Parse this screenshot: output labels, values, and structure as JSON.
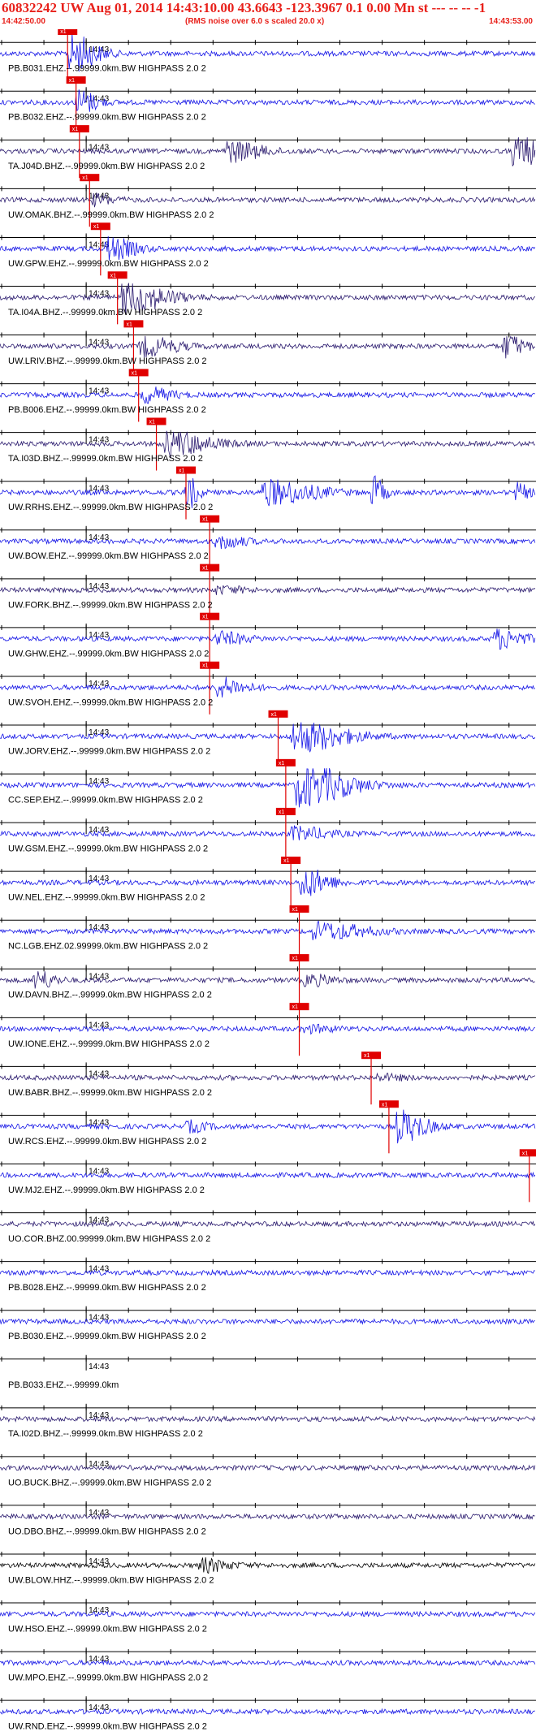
{
  "header": {
    "title": "60832242 UW Aug 01, 2014 14:43:10.00   43.6643 -123.3967  0.1 0.00 Mn st --- -- --  -1",
    "start_time": "14:42:50.00",
    "note": "(RMS noise over 6.0 s scaled 20.0 x)",
    "end_time": "14:43:53.00"
  },
  "colors": {
    "header_text": "#e8201a",
    "trace_blue": "#1414e6",
    "trace_dark": "#2a1a6e",
    "trace_black": "#000000",
    "pick": "#e00000"
  },
  "chart_data": {
    "type": "line",
    "title": "60832242 UW Aug 01, 2014 14:43:10.00   43.6643 -123.3967  0.1 0.00 Mn st --- -- --  -1",
    "x_range_time": [
      "14:42:50.00",
      "14:43:53.00"
    ],
    "x_tick_label": "14:43",
    "pick_label": "x1",
    "series": [
      {
        "name": "PB.B031.EHZ.--.99999.0km.BW_HIGHPASS_2.0_2",
        "label": "PB.B031.EHZ.--.99999.0km.BW  HIGHPASS  2.0  2",
        "pick": "14:42:57.8",
        "burst": [
          {
            "t": "14:42:58.0",
            "amp": 0.95,
            "dur": 3
          }
        ],
        "color": "blue"
      },
      {
        "name": "PB.B032.EHZ.--.99999.0km.BW_HIGHPASS_2.0_2",
        "label": "PB.B032.EHZ.--.99999.0km.BW  HIGHPASS  2.0  2",
        "pick": "14:42:58.8",
        "burst": [
          {
            "t": "14:42:59.0",
            "amp": 0.6,
            "dur": 2
          }
        ],
        "color": "blue"
      },
      {
        "name": "TA.J04D.BHZ.--.99999.0km.BW_HIGHPASS_2.0_2",
        "label": "TA.J04D.BHZ.--.99999.0km.BW  HIGHPASS  2.0  2",
        "pick": "14:42:59.2",
        "burst": [
          {
            "t": "14:43:16.5",
            "amp": 0.5,
            "dur": 4
          },
          {
            "t": "14:43:50.5",
            "amp": 0.65,
            "dur": 7
          }
        ],
        "color": "dark"
      },
      {
        "name": "UW.OMAK.BHZ.--.99999.0km.BW_HIGHPASS_2.0_2",
        "label": "UW.OMAK.BHZ.--.99999.0km.BW  HIGHPASS  2.0  2",
        "pick": "14:43:00.4",
        "burst": [
          {
            "t": "14:43:01.0",
            "amp": 0.25,
            "dur": 2
          }
        ],
        "color": "dark"
      },
      {
        "name": "UW.GPW.EHZ.--.99999.0km.BW_HIGHPASS_2.0_2",
        "label": "UW.GPW.EHZ.--.99999.0km.BW  HIGHPASS  2.0  2",
        "pick": "14:43:01.7",
        "burst": [
          {
            "t": "14:43:02.5",
            "amp": 0.55,
            "dur": 3
          }
        ],
        "color": "blue"
      },
      {
        "name": "TA.I04A.BHZ.--.99999.0km.BW_HIGHPASS_2.0_2",
        "label": "TA.I04A.BHZ.--.99999.0km.BW  HIGHPASS  2.0  2",
        "pick": "14:43:03.7",
        "burst": [
          {
            "t": "14:43:04.5",
            "amp": 0.75,
            "dur": 5
          }
        ],
        "color": "dark"
      },
      {
        "name": "UW.LRIV.BHZ.--.99999.0km.BW_HIGHPASS_2.0_2",
        "label": "UW.LRIV.BHZ.--.99999.0km.BW  HIGHPASS  2.0  2",
        "pick": "14:43:05.6",
        "burst": [
          {
            "t": "14:43:06.5",
            "amp": 0.45,
            "dur": 4
          },
          {
            "t": "14:43:49.5",
            "amp": 0.55,
            "dur": 2
          }
        ],
        "color": "dark"
      },
      {
        "name": "PB.B006.EHZ.--.99999.0km.BW_HIGHPASS_2.0_2",
        "label": "PB.B006.EHZ.--.99999.0km.BW  HIGHPASS  2.0  2",
        "pick": "14:43:06.2",
        "burst": [
          {
            "t": "14:43:06.8",
            "amp": 0.35,
            "dur": 3
          }
        ],
        "color": "blue"
      },
      {
        "name": "TA.I03D.BHZ.--.99999.0km.BW_HIGHPASS_2.0_2",
        "label": "TA.I03D.BHZ.--.99999.0km.BW  HIGHPASS  2.0  2",
        "pick": "14:43:08.3",
        "burst": [
          {
            "t": "14:43:09.5",
            "amp": 0.6,
            "dur": 5
          }
        ],
        "color": "dark"
      },
      {
        "name": "UW.RRHS.EHZ.--.99999.0km.BW_HIGHPASS_2.0_2",
        "label": "UW.RRHS.EHZ.--.99999.0km.BW  HIGHPASS  2.0  2",
        "pick": "14:43:11.8",
        "burst": [
          {
            "t": "14:43:11.9",
            "amp": 0.8,
            "dur": 1
          },
          {
            "t": "14:43:21.0",
            "amp": 0.6,
            "dur": 6
          },
          {
            "t": "14:43:34.0",
            "amp": 0.7,
            "dur": 1
          },
          {
            "t": "14:43:51.0",
            "amp": 0.4,
            "dur": 1
          }
        ],
        "color": "blue"
      },
      {
        "name": "UW.BOW.EHZ.--.99999.0km.BW_HIGHPASS_2.0_2",
        "label": "UW.BOW.EHZ.--.99999.0km.BW  HIGHPASS  2.0  2",
        "pick": "14:43:14.6",
        "burst": [
          {
            "t": "14:43:15.5",
            "amp": 0.3,
            "dur": 3
          }
        ],
        "color": "blue"
      },
      {
        "name": "UW.FORK.BHZ.--.99999.0km.BW_HIGHPASS_2.0_2",
        "label": "UW.FORK.BHZ.--.99999.0km.BW  HIGHPASS  2.0  2",
        "pick": "14:43:14.6",
        "burst": [
          {
            "t": "14:43:15.5",
            "amp": 0.15,
            "dur": 3
          }
        ],
        "color": "dark"
      },
      {
        "name": "UW.GHW.EHZ.--.99999.0km.BW_HIGHPASS_2.0_2",
        "label": "UW.GHW.EHZ.--.99999.0km.BW  HIGHPASS  2.0  2",
        "pick": "14:43:14.6",
        "burst": [
          {
            "t": "14:43:15.5",
            "amp": 0.3,
            "dur": 3
          },
          {
            "t": "14:43:48.5",
            "amp": 0.45,
            "dur": 3
          }
        ],
        "color": "blue"
      },
      {
        "name": "UW.SVOH.EHZ.--.99999.0km.BW_HIGHPASS_2.0_2",
        "label": "UW.SVOH.EHZ.--.99999.0km.BW  HIGHPASS  2.0  2",
        "pick": "14:43:14.6",
        "burst": [
          {
            "t": "14:43:15.5",
            "amp": 0.45,
            "dur": 3
          }
        ],
        "color": "blue"
      },
      {
        "name": "UW.JORV.EHZ.--.99999.0km.BW_HIGHPASS_2.0_2",
        "label": "UW.JORV.EHZ.--.99999.0km.BW  HIGHPASS  2.0  2",
        "pick": "14:43:22.7",
        "burst": [
          {
            "t": "14:43:24.5",
            "amp": 0.75,
            "dur": 6
          }
        ],
        "color": "blue"
      },
      {
        "name": "CC.SEP.EHZ.--.99999.0km.BW_HIGHPASS_2.0_2",
        "label": "CC.SEP.EHZ.--.99999.0km.BW  HIGHPASS  2.0  2",
        "pick": "14:43:23.6",
        "burst": [
          {
            "t": "14:43:25.0",
            "amp": 1.0,
            "dur": 6
          }
        ],
        "color": "blue"
      },
      {
        "name": "UW.GSM.EHZ.--.99999.0km.BW_HIGHPASS_2.0_2",
        "label": "UW.GSM.EHZ.--.99999.0km.BW  HIGHPASS  2.0  2",
        "pick": "14:43:23.6",
        "burst": [
          {
            "t": "14:43:24.5",
            "amp": 0.3,
            "dur": 4
          }
        ],
        "color": "blue"
      },
      {
        "name": "UW.NEL.EHZ.--.99999.0km.BW_HIGHPASS_2.0_2",
        "label": "UW.NEL.EHZ.--.99999.0km.BW  HIGHPASS  2.0  2",
        "pick": "14:43:24.2",
        "burst": [
          {
            "t": "14:43:25.5",
            "amp": 0.7,
            "dur": 3
          }
        ],
        "color": "blue"
      },
      {
        "name": "NC.LGB.EHZ.02.99999.0km.BW_HIGHPASS_2.0_2",
        "label": "NC.LGB.EHZ.02.99999.0km.BW  HIGHPASS  2.0  2",
        "pick": "14:43:25.2",
        "burst": [
          {
            "t": "14:43:27.0",
            "amp": 0.4,
            "dur": 6
          }
        ],
        "color": "blue"
      },
      {
        "name": "UW.DAVN.BHZ.--.99999.0km.BW_HIGHPASS_2.0_2",
        "label": "UW.DAVN.BHZ.--.99999.0km.BW  HIGHPASS  2.0  2",
        "pick": "14:43:25.2",
        "burst": [
          {
            "t": "14:42:54.0",
            "amp": 0.45,
            "dur": 2
          },
          {
            "t": "14:43:26.0",
            "amp": 0.25,
            "dur": 3
          }
        ],
        "color": "dark"
      },
      {
        "name": "UW.IONE.EHZ.--.99999.0km.BW_HIGHPASS_2.0_2",
        "label": "UW.IONE.EHZ.--.99999.0km.BW  HIGHPASS  2.0  2",
        "pick": "14:43:25.2",
        "burst": [
          {
            "t": "14:43:26.0",
            "amp": 0.15,
            "dur": 3
          }
        ],
        "color": "blue"
      },
      {
        "name": "UW.BABR.BHZ.--.99999.0km.BW_HIGHPASS_2.0_2",
        "label": "UW.BABR.BHZ.--.99999.0km.BW  HIGHPASS  2.0  2",
        "pick": "14:43:33.7",
        "burst": [
          {
            "t": "14:43:34.5",
            "amp": 0.12,
            "dur": 3
          }
        ],
        "color": "dark"
      },
      {
        "name": "UW.RCS.EHZ.--.99999.0km.BW_HIGHPASS_2.0_2",
        "label": "UW.RCS.EHZ.--.99999.0km.BW  HIGHPASS  2.0  2",
        "pick": "14:43:35.8",
        "burst": [
          {
            "t": "14:43:37.0",
            "amp": 0.75,
            "dur": 3
          },
          {
            "t": "14:43:12.0",
            "amp": 0.25,
            "dur": 2
          }
        ],
        "color": "blue"
      },
      {
        "name": "UW.MJ2.EHZ.--.99999.0km.BW_HIGHPASS_2.0_2",
        "label": "UW.MJ2.EHZ.--.99999.0km.BW  HIGHPASS  2.0  2",
        "pick": "14:43:52.4",
        "burst": [],
        "color": "blue"
      },
      {
        "name": "UO.COR.BHZ.00.99999.0km.BW_HIGHPASS_2.0_2",
        "label": "UO.COR.BHZ.00.99999.0km.BW  HIGHPASS  2.0  2",
        "pick": null,
        "burst": [],
        "color": "dark"
      },
      {
        "name": "PB.B028.EHZ.--.99999.0km.BW_HIGHPASS_2.0_2",
        "label": "PB.B028.EHZ.--.99999.0km.BW  HIGHPASS  2.0  2",
        "pick": null,
        "burst": [],
        "color": "blue"
      },
      {
        "name": "PB.B030.EHZ.--.99999.0km.BW_HIGHPASS_2.0_2",
        "label": "PB.B030.EHZ.--.99999.0km.BW  HIGHPASS  2.0  2",
        "pick": null,
        "burst": [],
        "color": "blue"
      },
      {
        "name": "PB.B033.EHZ.--.99999.0km",
        "label": "PB.B033.EHZ.--.99999.0km",
        "pick": null,
        "burst": [],
        "color": "none"
      },
      {
        "name": "TA.I02D.BHZ.--.99999.0km.BW_HIGHPASS_2.0_2",
        "label": "TA.I02D.BHZ.--.99999.0km.BW  HIGHPASS  2.0  2",
        "pick": null,
        "burst": [],
        "color": "dark"
      },
      {
        "name": "UO.BUCK.BHZ.--.99999.0km.BW_HIGHPASS_2.0_2",
        "label": "UO.BUCK.BHZ.--.99999.0km.BW  HIGHPASS  2.0  2",
        "pick": null,
        "burst": [],
        "color": "dark"
      },
      {
        "name": "UO.DBO.BHZ.--.99999.0km.BW_HIGHPASS_2.0_2",
        "label": "UO.DBO.BHZ.--.99999.0km.BW  HIGHPASS  2.0  2",
        "pick": null,
        "burst": [],
        "color": "dark"
      },
      {
        "name": "UW.BLOW.HHZ.--.99999.0km.BW_HIGHPASS_2.0_2",
        "label": "UW.BLOW.HHZ.--.99999.0km.BW  HIGHPASS  2.0  2",
        "pick": null,
        "burst": [
          {
            "t": "14:43:13.5",
            "amp": 0.3,
            "dur": 3
          }
        ],
        "color": "black"
      },
      {
        "name": "UW.HSO.EHZ.--.99999.0km.BW_HIGHPASS_2.0_2",
        "label": "UW.HSO.EHZ.--.99999.0km.BW  HIGHPASS  2.0  2",
        "pick": null,
        "burst": [],
        "color": "blue"
      },
      {
        "name": "UW.MPO.EHZ.--.99999.0km.BW_HIGHPASS_2.0_2",
        "label": "UW.MPO.EHZ.--.99999.0km.BW  HIGHPASS  2.0  2",
        "pick": null,
        "burst": [],
        "color": "blue"
      },
      {
        "name": "UW.RND.EHZ.--.99999.0km.BW_HIGHPASS_2.0_2",
        "label": "UW.RND.EHZ.--.99999.0km.BW  HIGHPASS  2.0  2",
        "pick": null,
        "burst": [],
        "color": "blue"
      }
    ]
  }
}
